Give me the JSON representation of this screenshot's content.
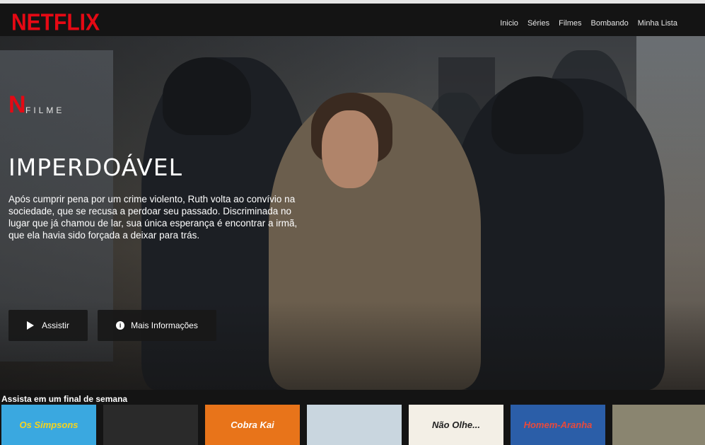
{
  "brand": {
    "logo_text": "NETFLIX",
    "accent_color": "#e50914"
  },
  "nav": {
    "links": [
      "Inicio",
      "Séries",
      "Filmes",
      "Bombando",
      "Minha Lista"
    ]
  },
  "hero": {
    "badge_letter": "N",
    "type_label": "FILME",
    "title": "IMPERDOÁVEL",
    "description": "Após cumprir pena por um crime violento, Ruth volta ao convívio na sociedade, que se recusa a perdoar seu passado. Discriminada no lugar que já chamou de lar, sua única esperança é encontrar a irmã, que ela havia sido forçada a deixar para trás.",
    "play_button_label": "Assistir",
    "info_button_label": "Mais Informações",
    "info_icon_glyph": "i"
  },
  "row": {
    "title": "Assista em um final de semana",
    "thumbnails": [
      {
        "text": "Os Simpsons",
        "bg": "#3aa8e0",
        "fg": "#f7d31c"
      },
      {
        "text": "",
        "bg": "#2a2a2a",
        "fg": "#ffffff"
      },
      {
        "text": "Cobra Kai",
        "bg": "#e8741a",
        "fg": "#ffffff"
      },
      {
        "text": "",
        "bg": "#c9d6df",
        "fg": "#333333"
      },
      {
        "text": "Não Olhe...",
        "bg": "#f3efe6",
        "fg": "#222222"
      },
      {
        "text": "Homem-Aranha",
        "bg": "#2b5ea8",
        "fg": "#e84a3c"
      },
      {
        "text": "",
        "bg": "#8a8570",
        "fg": "#ffffff"
      }
    ]
  }
}
